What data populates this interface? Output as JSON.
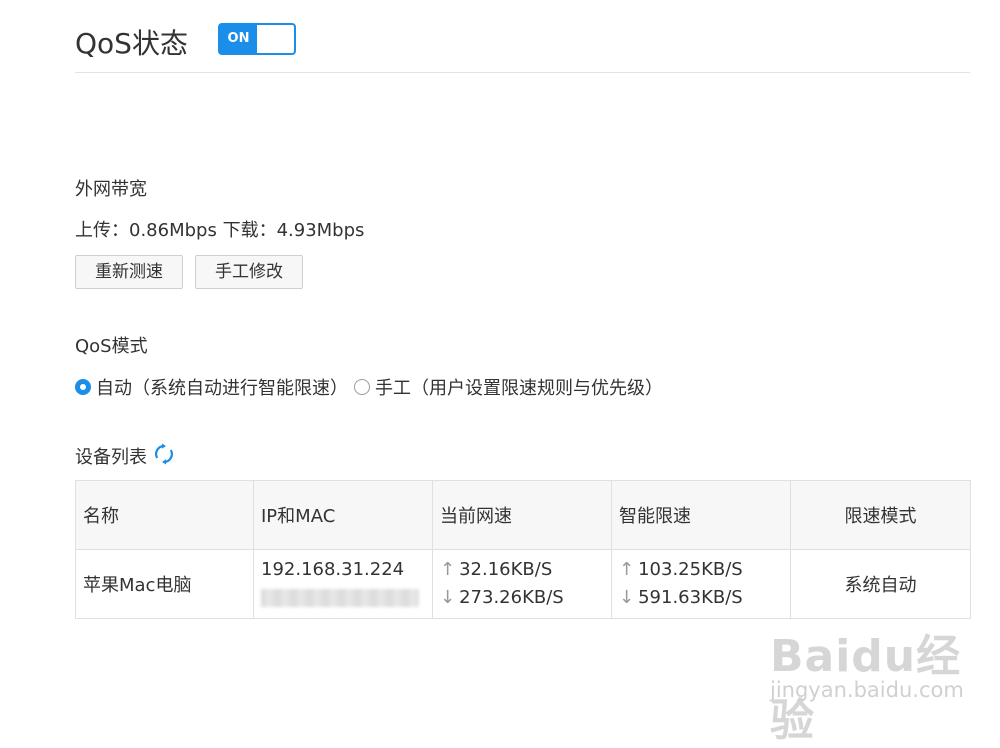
{
  "header": {
    "title": "QoS状态",
    "toggle": {
      "label": "ON",
      "state": "on",
      "color": "#1a8ee8"
    }
  },
  "bandwidth": {
    "title": "外网带宽",
    "upload_label": "上传：",
    "upload_value": "0.86Mbps",
    "download_label": "下载：",
    "download_value": "4.93Mbps",
    "retest_button": "重新测速",
    "manual_button": "手工修改"
  },
  "qos_mode": {
    "title": "QoS模式",
    "options": [
      {
        "label": "自动（系统自动进行智能限速）",
        "selected": true
      },
      {
        "label": "手工（用户设置限速规则与优先级）",
        "selected": false
      }
    ]
  },
  "device_list": {
    "title": "设备列表",
    "refresh_icon": "refresh-icon",
    "columns": [
      "名称",
      "IP和MAC",
      "当前网速",
      "智能限速",
      "限速模式"
    ],
    "rows": [
      {
        "name": "苹果Mac电脑",
        "ip": "192.168.31.224",
        "current_up": "32.16KB/S",
        "current_down": "273.26KB/S",
        "limit_up": "103.25KB/S",
        "limit_down": "591.63KB/S",
        "mode": "系统自动"
      }
    ]
  },
  "watermark": {
    "logo": "Baidu经验",
    "url": "jingyan.baidu.com"
  },
  "colors": {
    "accent": "#1a8ee8",
    "muted": "#999999",
    "border": "#e0e0e0"
  }
}
